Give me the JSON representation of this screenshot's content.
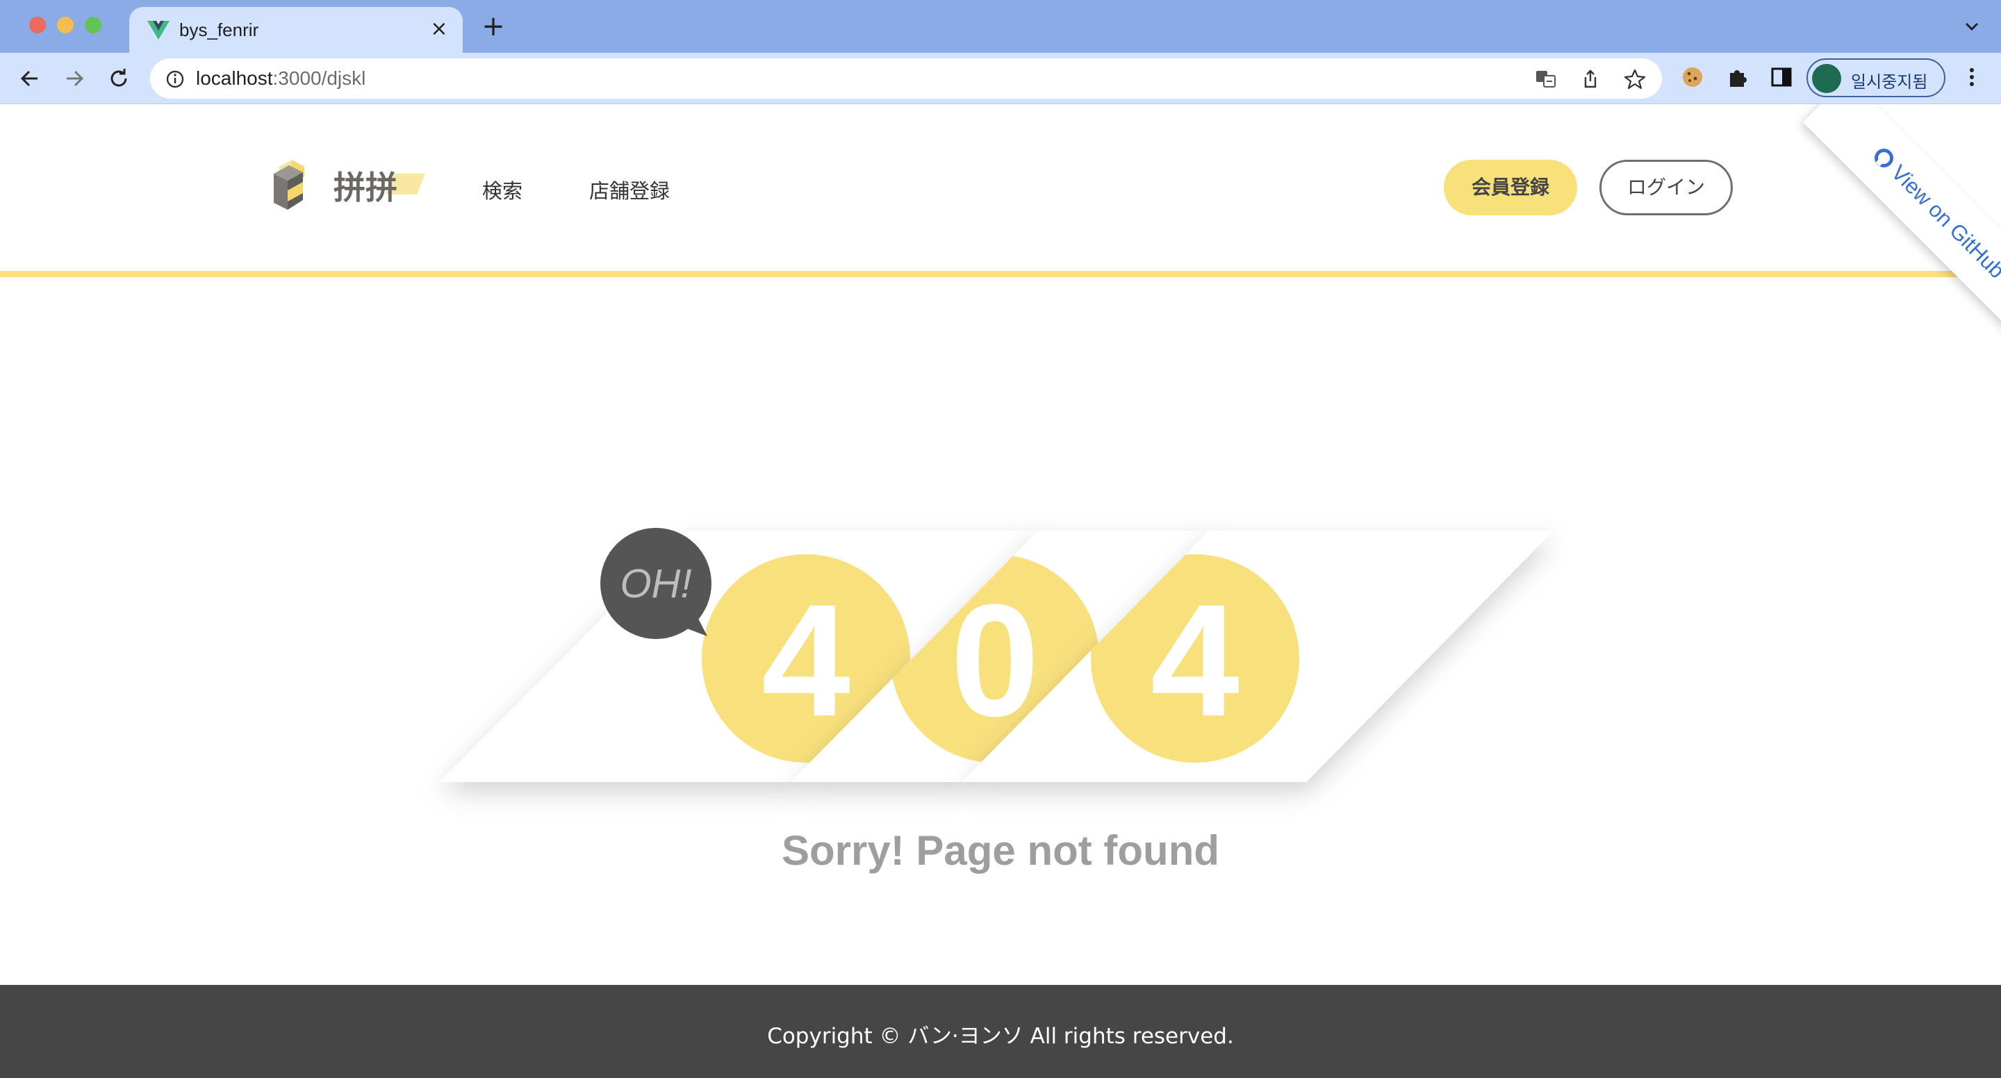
{
  "browser": {
    "tab_title": "bys_fenrir",
    "tab_close": "×",
    "new_tab": "+",
    "url_host": "localhost",
    "url_rest": ":3000/djskl",
    "profile_label": "일시중지됨"
  },
  "header": {
    "logo_text": "拼拼",
    "nav": [
      {
        "label": "検索"
      },
      {
        "label": "店舗登録"
      }
    ],
    "register_label": "会員登録",
    "login_label": "ログイン",
    "accent_color": "#f8e07b"
  },
  "github_ribbon": {
    "label": "View on GitHub"
  },
  "error": {
    "badge": "OH!",
    "digits": [
      "4",
      "0",
      "4"
    ],
    "message": "Sorry! Page not found",
    "circle_color": "#f8e07b",
    "badge_color": "#555555"
  },
  "footer": {
    "copyright": "Copyright © バン·ヨンソ All rights reserved.",
    "background": "#474646"
  }
}
